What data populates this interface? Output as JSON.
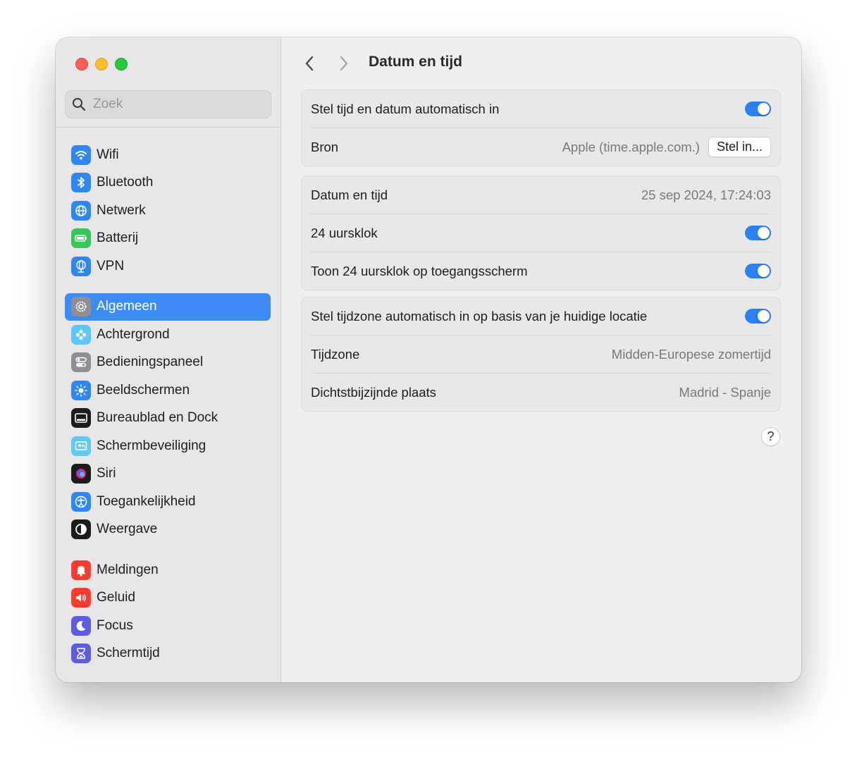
{
  "window": {
    "title": "Datum en tijd"
  },
  "search": {
    "placeholder": "Zoek"
  },
  "sidebar": {
    "groups": [
      [
        {
          "label": "Wifi",
          "icon": "wifi-icon",
          "color": "#2f87f6"
        },
        {
          "label": "Bluetooth",
          "icon": "bluetooth-icon",
          "color": "#2f87f6"
        },
        {
          "label": "Netwerk",
          "icon": "globe-icon",
          "color": "#2f87f6"
        },
        {
          "label": "Batterij",
          "icon": "battery-icon",
          "color": "#34c759"
        },
        {
          "label": "VPN",
          "icon": "vpn-globe-icon",
          "color": "#2f87f6"
        }
      ],
      [
        {
          "label": "Algemeen",
          "icon": "gear-icon",
          "color": "#8e8e93",
          "active": true
        },
        {
          "label": "Achtergrond",
          "icon": "flower-icon",
          "color": "#5ac8fa"
        },
        {
          "label": "Bedieningspaneel",
          "icon": "switches-icon",
          "color": "#8e8e93"
        },
        {
          "label": "Beeldschermen",
          "icon": "sun-icon",
          "color": "#2f87f6"
        },
        {
          "label": "Bureaublad en Dock",
          "icon": "dock-icon",
          "color": "#1c1c1e"
        },
        {
          "label": "Schermbeveiliging",
          "icon": "screensaver-icon",
          "color": "#64c8f5"
        },
        {
          "label": "Siri",
          "icon": "siri-icon",
          "color": "#1c1c1e"
        },
        {
          "label": "Toegankelijkheid",
          "icon": "accessibility-icon",
          "color": "#2f87f6"
        },
        {
          "label": "Weergave",
          "icon": "appearance-icon",
          "color": "#1c1c1e"
        }
      ],
      [
        {
          "label": "Meldingen",
          "icon": "bell-icon",
          "color": "#ff3b30"
        },
        {
          "label": "Geluid",
          "icon": "speaker-icon",
          "color": "#ff3b30"
        },
        {
          "label": "Focus",
          "icon": "moon-icon",
          "color": "#5e5ce6"
        },
        {
          "label": "Schermtijd",
          "icon": "hourglass-icon",
          "color": "#5e5ce6"
        }
      ]
    ]
  },
  "main": {
    "group1": {
      "auto_label": "Stel tijd en datum automatisch in",
      "auto_on": true,
      "source_label": "Bron",
      "source_value": "Apple (time.apple.com.)",
      "source_button": "Stel in..."
    },
    "group2": {
      "datetime_label": "Datum en tijd",
      "datetime_value": "25 sep 2024, 17:24:03",
      "clock24_label": "24 uursklok",
      "clock24_on": true,
      "lockscreen_label": "Toon 24 uursklok op toegangsscherm",
      "lockscreen_on": true
    },
    "group3": {
      "tz_auto_label": "Stel tijdzone automatisch in op basis van je huidige locatie",
      "tz_auto_on": true,
      "tz_label": "Tijdzone",
      "tz_value": "Midden-Europese zomertijd",
      "city_label": "Dichtstbijzijnde plaats",
      "city_value": "Madrid - Spanje"
    },
    "help": "?"
  },
  "colors": {
    "accent": "#2d7ff6",
    "sidebar_active": "#3d8cf6"
  }
}
